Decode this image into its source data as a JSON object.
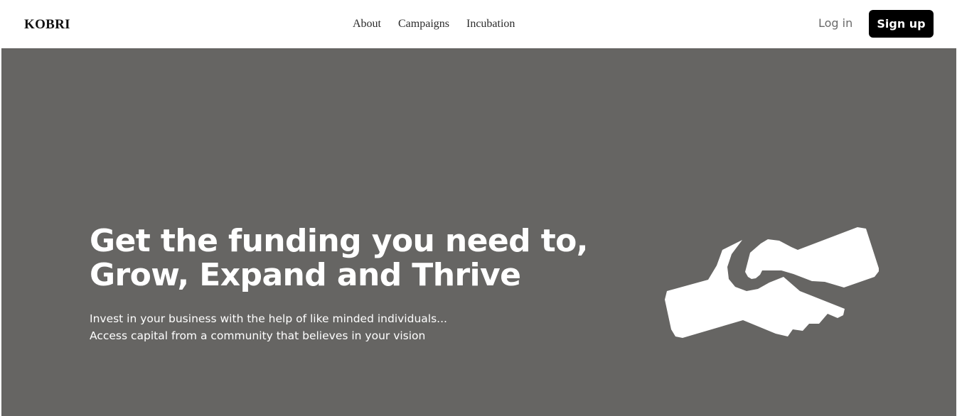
{
  "header": {
    "brand": "KOBRI",
    "nav": [
      {
        "label": "About"
      },
      {
        "label": "Campaigns"
      },
      {
        "label": "Incubation"
      }
    ],
    "login_label": "Log in",
    "signup_label": "Sign up"
  },
  "hero": {
    "title_line1": "Get the funding you need to,",
    "title_line2": "Grow, Expand and Thrive",
    "subtitle_line1": "Invest in your business with the help of like minded individuals...",
    "subtitle_line2": "Access capital from a community that believes in your vision",
    "illustration_icon": "handshake-icon"
  },
  "colors": {
    "hero_background": "#666563",
    "header_background": "#ffffff",
    "button_background": "#000000",
    "hero_text": "#ffffff"
  }
}
